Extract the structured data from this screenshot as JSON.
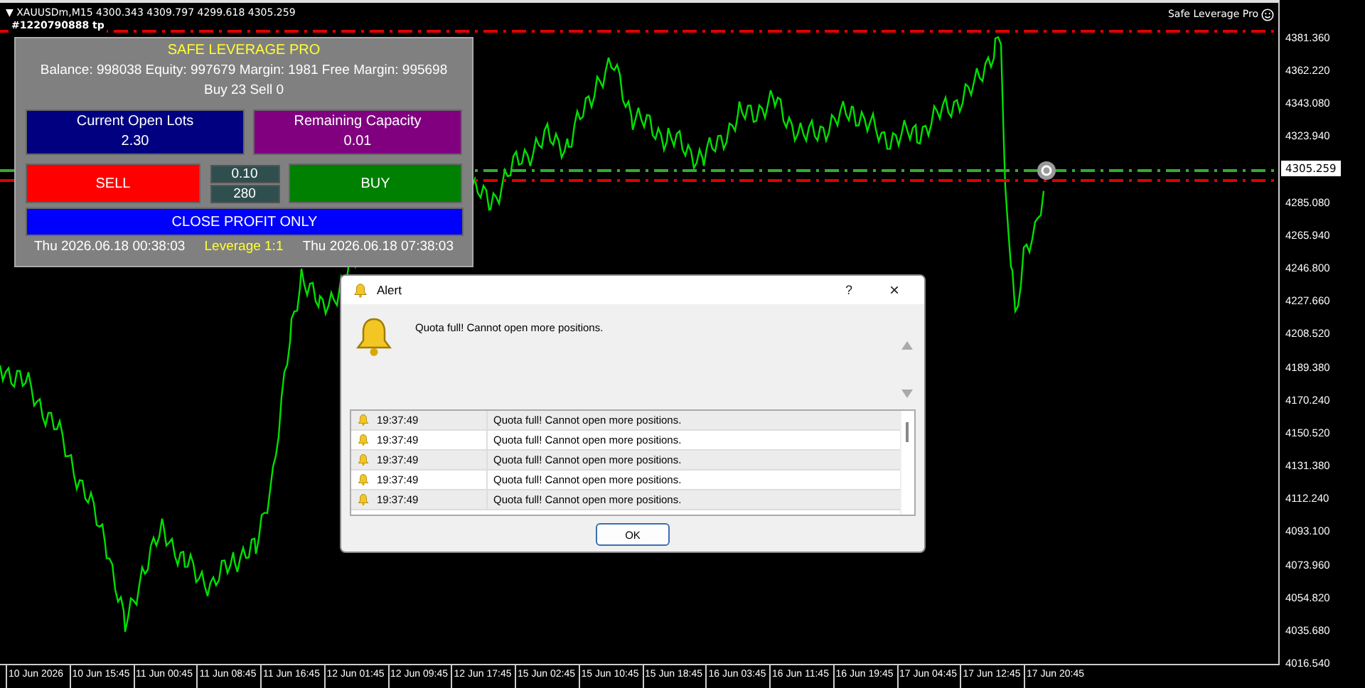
{
  "chart_header": {
    "menu_glyph": "▼",
    "symbol_line": "XAUUSDm,M15 4300.343 4309.797 4299.618 4305.259",
    "trade_label": "#1220790888 tp"
  },
  "expert_label": "Safe Leverage Pro",
  "panel": {
    "title": "SAFE LEVERAGE PRO",
    "account": "Balance: 998038 Equity: 997679 Margin: 1981 Free Margin: 995698",
    "positions": "Buy 23 Sell 0",
    "stats": [
      {
        "label": "Current Open Lots",
        "value": "2.30",
        "color": "#000080"
      },
      {
        "label": "Remaining Capacity",
        "value": "0.01",
        "color": "#800080"
      }
    ],
    "sell": "SELL",
    "lot": "0.10",
    "points": "280",
    "buy": "BUY",
    "close_profit": "CLOSE PROFIT ONLY",
    "start_time": "Thu 2026.06.18 00:38:03",
    "leverage": "Leverage 1:1",
    "end_time": "Thu 2026.06.18 07:38:03"
  },
  "price_axis": {
    "labels": [
      "4381.360",
      "4362.220",
      "4343.080",
      "4323.940",
      "4305.259",
      "4285.080",
      "4265.940",
      "4246.800",
      "4227.660",
      "4208.520",
      "4189.380",
      "4170.240",
      "4150.520",
      "4131.380",
      "4112.240",
      "4093.100",
      "4073.960",
      "4054.820",
      "4035.680",
      "4016.540"
    ]
  },
  "time_axis": [
    "10 Jun 2026",
    "10 Jun 15:45",
    "11 Jun 00:45",
    "11 Jun 08:45",
    "11 Jun 16:45",
    "12 Jun 01:45",
    "12 Jun 09:45",
    "12 Jun 17:45",
    "15 Jun 02:45",
    "15 Jun 10:45",
    "15 Jun 18:45",
    "16 Jun 03:45",
    "16 Jun 11:45",
    "16 Jun 19:45",
    "17 Jun 04:45",
    "17 Jun 12:45",
    "17 Jun 20:45"
  ],
  "alert": {
    "title": "Alert",
    "help": "?",
    "close": "×",
    "message": "Quota full! Cannot open more positions.",
    "log": [
      {
        "time": "19:37:49",
        "message": "Quota full! Cannot open more positions."
      },
      {
        "time": "19:37:49",
        "message": "Quota full! Cannot open more positions."
      },
      {
        "time": "19:37:49",
        "message": "Quota full! Cannot open more positions."
      },
      {
        "time": "19:37:49",
        "message": "Quota full! Cannot open more positions."
      },
      {
        "time": "19:37:49",
        "message": "Quota full! Cannot open more positions."
      }
    ],
    "button": "OK"
  }
}
